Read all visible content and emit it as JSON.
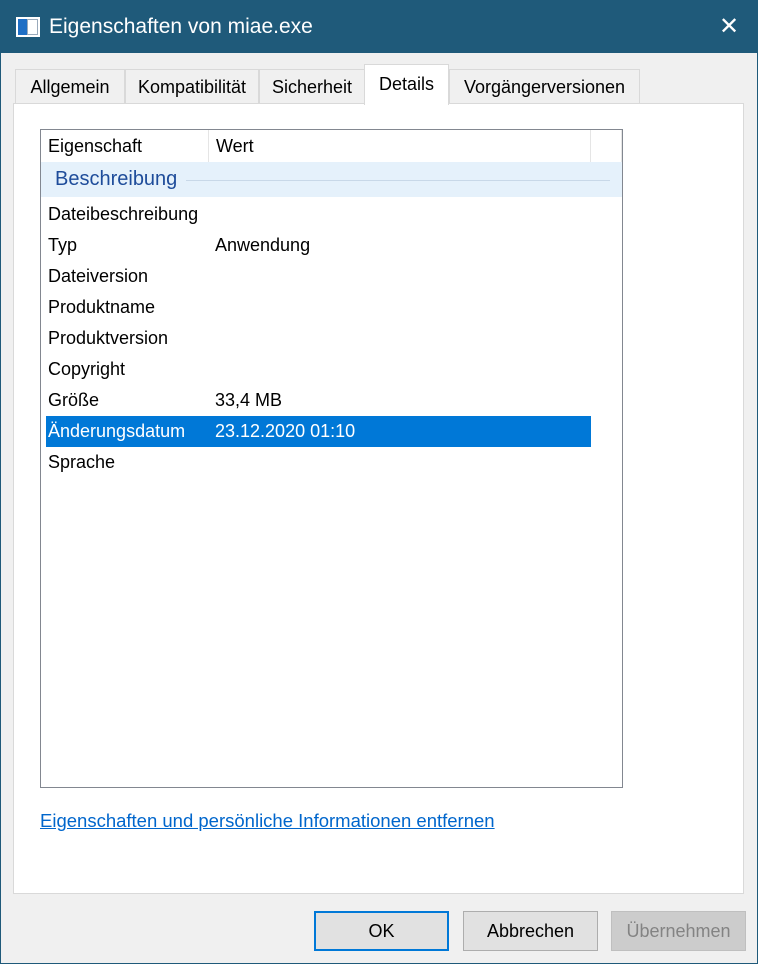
{
  "window": {
    "title": "Eigenschaften von miae.exe",
    "close_symbol": "✕"
  },
  "tabs": [
    {
      "label": "Allgemein"
    },
    {
      "label": "Kompatibilität"
    },
    {
      "label": "Sicherheit"
    },
    {
      "label": "Details",
      "active": true
    },
    {
      "label": "Vorgängerversionen"
    }
  ],
  "list": {
    "headers": {
      "property": "Eigenschaft",
      "value": "Wert"
    },
    "group": "Beschreibung",
    "rows": [
      {
        "name": "Dateibeschreibung",
        "value": ""
      },
      {
        "name": "Typ",
        "value": "Anwendung"
      },
      {
        "name": "Dateiversion",
        "value": ""
      },
      {
        "name": "Produktname",
        "value": ""
      },
      {
        "name": "Produktversion",
        "value": ""
      },
      {
        "name": "Copyright",
        "value": ""
      },
      {
        "name": "Größe",
        "value": "33,4 MB"
      },
      {
        "name": "Änderungsdatum",
        "value": "23.12.2020 01:10",
        "selected": true
      },
      {
        "name": "Sprache",
        "value": ""
      }
    ]
  },
  "link": "Eigenschaften und persönliche Informationen entfernen",
  "buttons": {
    "ok": "OK",
    "cancel": "Abbrechen",
    "apply": "Übernehmen"
  },
  "colors": {
    "titlebar": "#1f5a7a",
    "selection": "#0078d7",
    "link": "#0066cc"
  }
}
